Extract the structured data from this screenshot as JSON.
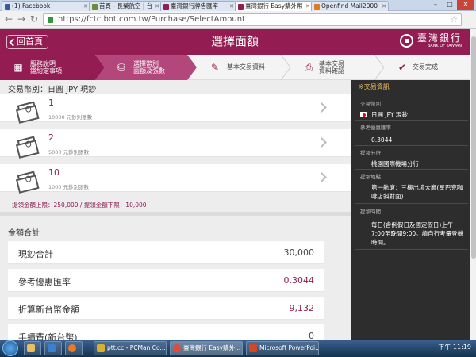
{
  "browser": {
    "tabs": [
      {
        "label": "(1) Facebook",
        "color": "#3b5998"
      },
      {
        "label": "首頁 - 長榮航空 | 台",
        "color": "#6a8d3a"
      },
      {
        "label": "臺灣銀行牌告匯率",
        "color": "#931d52"
      },
      {
        "label": "臺灣銀行 Easy購外幣",
        "color": "#931d52"
      },
      {
        "label": "Openfind Mail2000",
        "color": "#e07b20"
      }
    ],
    "url": "https://fctc.bot.com.tw/Purchase/SelectAmount",
    "window_buttons": [
      "–",
      "□",
      "✕"
    ]
  },
  "header": {
    "back_label": "回首頁",
    "title": "選擇面額",
    "logo_zh": "臺灣銀行",
    "logo_en": "BANK OF TAIWAN",
    "color": "#931d52"
  },
  "steps": [
    {
      "line1": "服務說明",
      "line2": "鑑約定事項",
      "icon": "grid-icon",
      "state": "done"
    },
    {
      "line1": "選擇幣別",
      "line2": "面額及張數",
      "icon": "coins-icon",
      "state": "current"
    },
    {
      "line1": "基本交易資料",
      "line2": "",
      "icon": "edit-icon",
      "state": "todo"
    },
    {
      "line1": "基本交易",
      "line2": "資料確認",
      "icon": "confirm-icon",
      "state": "todo"
    },
    {
      "line1": "交易完成",
      "line2": "",
      "icon": "check-icon",
      "state": "todo"
    }
  ],
  "main": {
    "currency_line": "交易幣別：日圓 JPY 現鈔",
    "denominations": [
      {
        "qty": "1",
        "sub": "10000 元鈔別張數"
      },
      {
        "qty": "2",
        "sub": "5000 元鈔別張數"
      },
      {
        "qty": "10",
        "sub": "1000 元鈔別張數"
      }
    ],
    "limit_text": "提領金額上限：250,000 / 提領金額下限：10,000",
    "summary_title": "金額合計",
    "summary_rows": [
      {
        "key": "現鈔合計",
        "value": "30,000"
      },
      {
        "key": "參考優惠匯率",
        "value": "0.3044"
      },
      {
        "key": "折算新台幣金額",
        "value": "9,132"
      },
      {
        "key": "手續費(新台幣)",
        "value": "0"
      }
    ]
  },
  "sidebar": {
    "title": "※交易資訊",
    "items": [
      {
        "label": "交易幣別",
        "value": "日圓 JPY 現鈔"
      },
      {
        "label": "參考優惠匯率",
        "value": "0.3044"
      },
      {
        "label": "提領分行",
        "value": "桃園國際機場分行"
      },
      {
        "label": "提領地點",
        "value": "第一航廈：三樓出境大廳(星巴克咖啡店斜對面)"
      },
      {
        "label": "提領時間",
        "value": "每日(含例假日及國定假日)上午7:00至晚間9:00。請自行考量登機時間。"
      }
    ]
  },
  "taskbar": {
    "items": [
      {
        "label": "ptt.cc - PCMan Co...",
        "color": "#d8b030"
      },
      {
        "label": "臺灣銀行 Easy購外...",
        "color": "#e04b3a"
      },
      {
        "label": "Microsoft PowerPoi...",
        "color": "#d24726"
      }
    ],
    "tray_text": "下午 11:19"
  }
}
